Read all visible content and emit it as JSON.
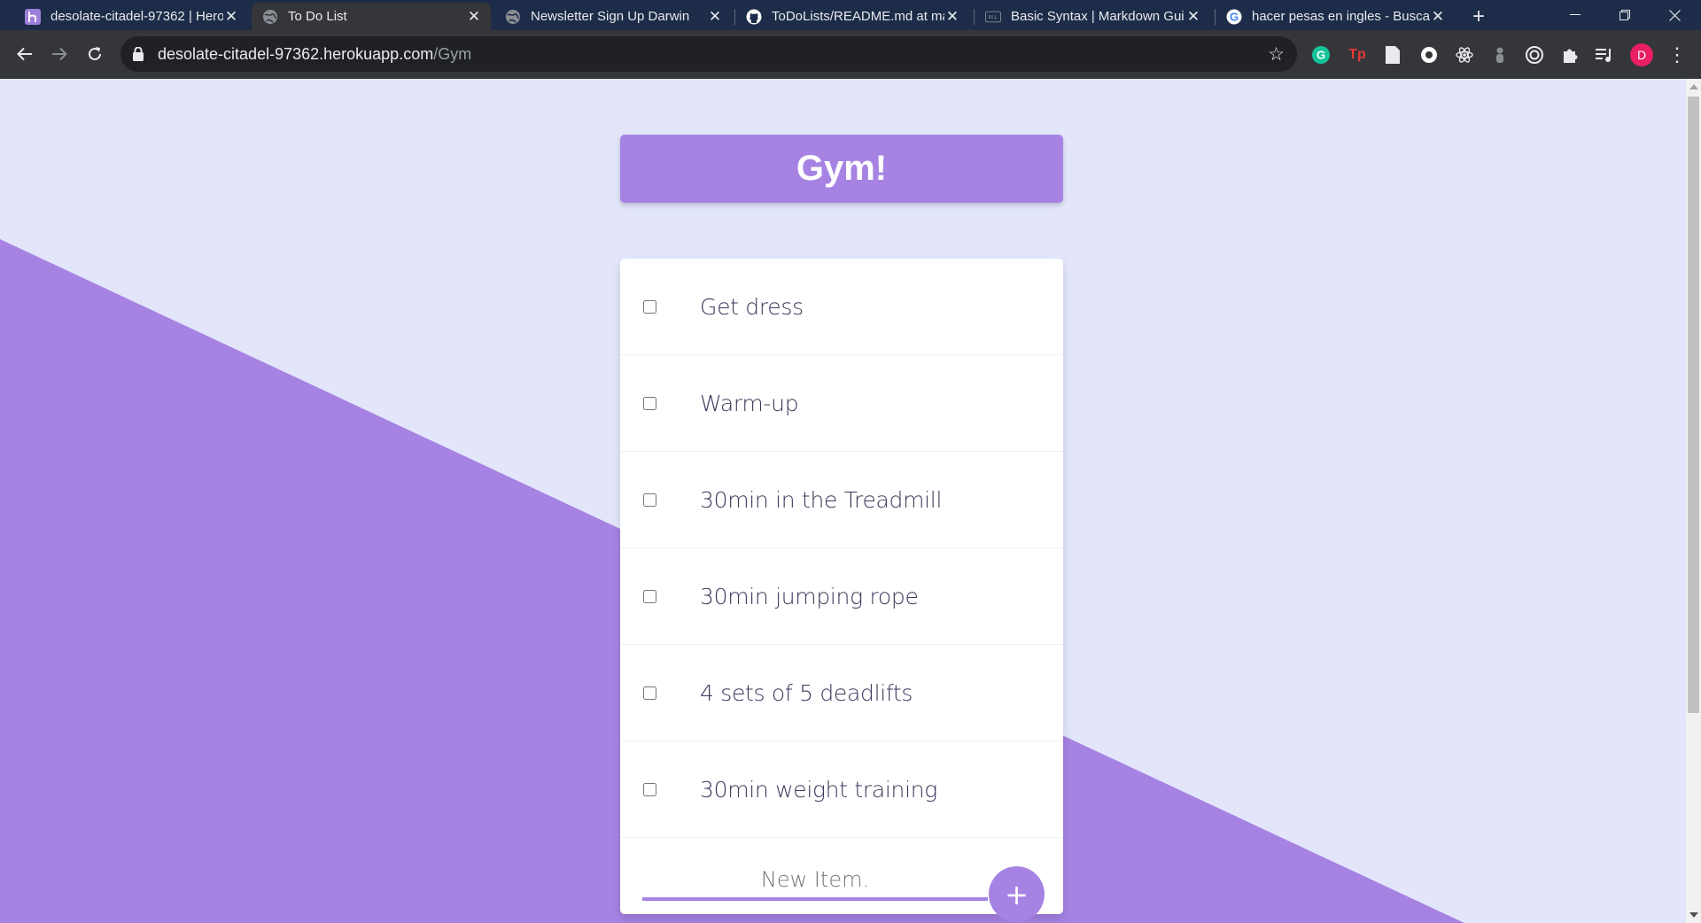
{
  "browser": {
    "tabs": [
      {
        "title": "desolate-citadel-97362 | Hero",
        "icon": "heroku-icon",
        "active": false
      },
      {
        "title": "To Do List",
        "icon": "globe-icon",
        "active": true
      },
      {
        "title": "Newsletter Sign Up Darwin",
        "icon": "globe-icon",
        "active": false
      },
      {
        "title": "ToDoLists/README.md at ma",
        "icon": "github-icon",
        "active": false
      },
      {
        "title": "Basic Syntax | Markdown Gui",
        "icon": "markdown-icon",
        "active": false
      },
      {
        "title": "hacer pesas en ingles - Busca",
        "icon": "google-icon",
        "active": false
      }
    ],
    "new_tab": "+",
    "address": {
      "host": "desolate-citadel-97362.herokuapp.com",
      "path": "/Gym"
    },
    "profile_initial": "D",
    "colors": {
      "tabstrip": "#1d2c48",
      "toolbar": "#35363a",
      "avatar": "#e91e63"
    }
  },
  "page": {
    "title": "Gym!",
    "items": [
      {
        "text": "Get dress",
        "checked": false
      },
      {
        "text": "Warm-up",
        "checked": false
      },
      {
        "text": "30min in the Treadmill",
        "checked": false
      },
      {
        "text": "30min jumping rope",
        "checked": false
      },
      {
        "text": "4 sets of 5 deadlifts",
        "checked": false
      },
      {
        "text": "30min weight training",
        "checked": false
      }
    ],
    "new_item_placeholder": "New Item.",
    "add_button_label": "+",
    "colors": {
      "accent": "#a683e3",
      "background": "#e3e6fb",
      "card": "#ffffff"
    }
  }
}
